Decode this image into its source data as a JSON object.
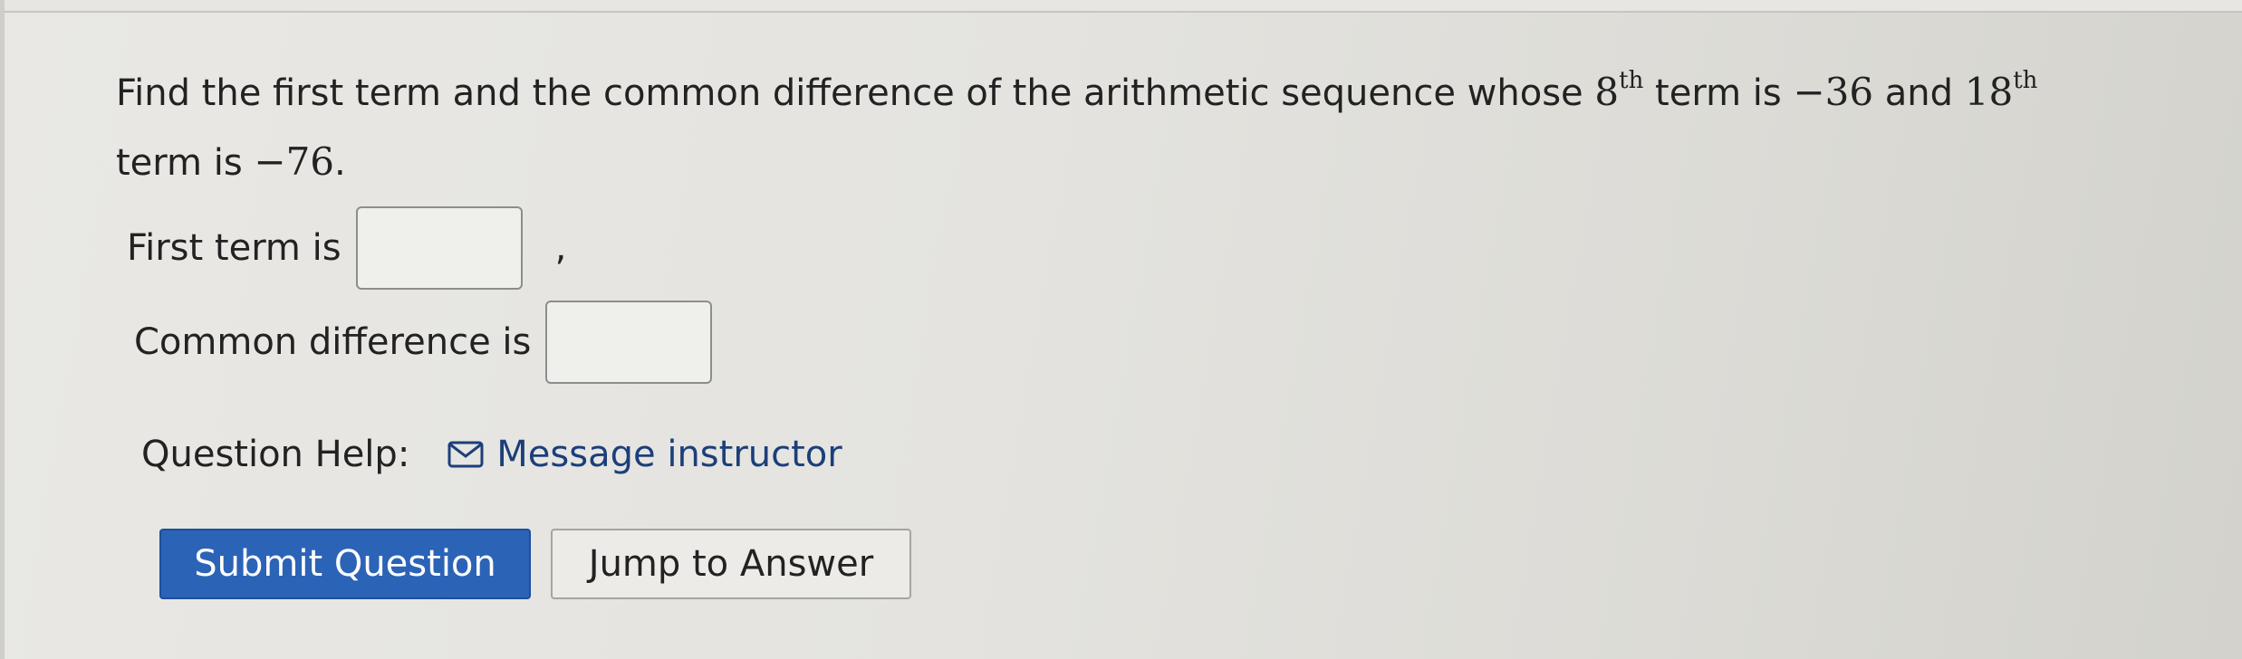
{
  "problem": {
    "part1": "Find the first term and the common difference of the arithmetic sequence whose ",
    "n1": "8",
    "n1_suffix": "th",
    "part2": " term is ",
    "v1": "−36",
    "part3": " and ",
    "n2": "18",
    "n2_suffix": "th",
    "part4": "term is ",
    "v2": "−76",
    "part5": "."
  },
  "fields": {
    "first_term_label": "First term is",
    "comma": ",",
    "common_difference_label": "Common difference is"
  },
  "help": {
    "label": "Question Help:",
    "message_link": "Message instructor"
  },
  "buttons": {
    "submit": "Submit Question",
    "jump": "Jump to Answer"
  },
  "colors": {
    "submit_bg": "#2b63b7",
    "link": "#1c3f7a"
  }
}
